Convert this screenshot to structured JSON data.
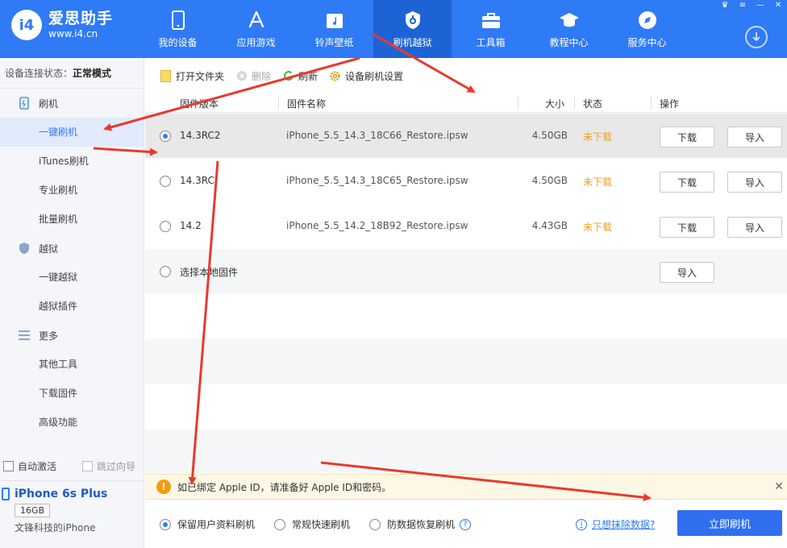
{
  "app": {
    "name": "爱思助手",
    "url": "www.i4.cn",
    "logo_letter": "i4"
  },
  "nav": [
    {
      "label": "我的设备",
      "icon": "phone-icon",
      "active": false
    },
    {
      "label": "应用游戏",
      "icon": "app-store-icon",
      "active": false
    },
    {
      "label": "铃声壁纸",
      "icon": "music-icon",
      "active": false
    },
    {
      "label": "刷机越狱",
      "icon": "shield-icon",
      "active": true
    },
    {
      "label": "工具箱",
      "icon": "toolbox-icon",
      "active": false
    },
    {
      "label": "教程中心",
      "icon": "graduation-icon",
      "active": false
    },
    {
      "label": "服务中心",
      "icon": "compass-icon",
      "active": false
    }
  ],
  "sidebar": {
    "conn_label": "设备连接状态：",
    "conn_value": "正常模式",
    "groups": [
      {
        "label": "刷机",
        "icon": "flash-phone-icon",
        "items": [
          "一键刷机",
          "iTunes刷机",
          "专业刷机",
          "批量刷机"
        ]
      },
      {
        "label": "越狱",
        "icon": "jailbreak-icon",
        "items": [
          "一键越狱",
          "越狱插件"
        ]
      },
      {
        "label": "更多",
        "icon": "menu-icon",
        "items": [
          "其他工具",
          "下载固件",
          "高级功能"
        ]
      }
    ],
    "active_item": "一键刷机",
    "auto_activate": "自动激活",
    "skip_guide": "跳过向导",
    "device": {
      "name": "iPhone 6s Plus",
      "storage": "16GB",
      "owner": "文锋科技的iPhone"
    }
  },
  "toolbar": {
    "open_folder": "打开文件夹",
    "delete": "删除",
    "refresh": "刷新",
    "settings": "设备刷机设置"
  },
  "table": {
    "headers": {
      "version": "固件版本",
      "name": "固件名称",
      "size": "大小",
      "status": "状态",
      "action": "操作"
    },
    "rows": [
      {
        "version": "14.3RC2",
        "name": "iPhone_5.5_14.3_18C66_Restore.ipsw",
        "size": "4.50GB",
        "status": "未下载",
        "download": "下载",
        "import": "导入",
        "selected": true
      },
      {
        "version": "14.3RC",
        "name": "iPhone_5.5_14.3_18C65_Restore.ipsw",
        "size": "4.50GB",
        "status": "未下载",
        "download": "下载",
        "import": "导入",
        "selected": false
      },
      {
        "version": "14.2",
        "name": "iPhone_5.5_14.2_18B92_Restore.ipsw",
        "size": "4.43GB",
        "status": "未下载",
        "download": "下载",
        "import": "导入",
        "selected": false
      }
    ],
    "local": {
      "label": "选择本地固件",
      "import": "导入"
    }
  },
  "notice": {
    "text": "如已绑定 Apple ID，请准备好 Apple ID和密码。",
    "close": "✕"
  },
  "options": {
    "keep_data": "保留用户资料刷机",
    "quick": "常规快速刷机",
    "recovery": "防数据恢复刷机",
    "erase_link": "只想抹除数据?",
    "flash_button": "立即刷机"
  },
  "colors": {
    "primary": "#2f7af5",
    "status_orange": "#f0a020",
    "arrow_red": "#e83a2e"
  }
}
